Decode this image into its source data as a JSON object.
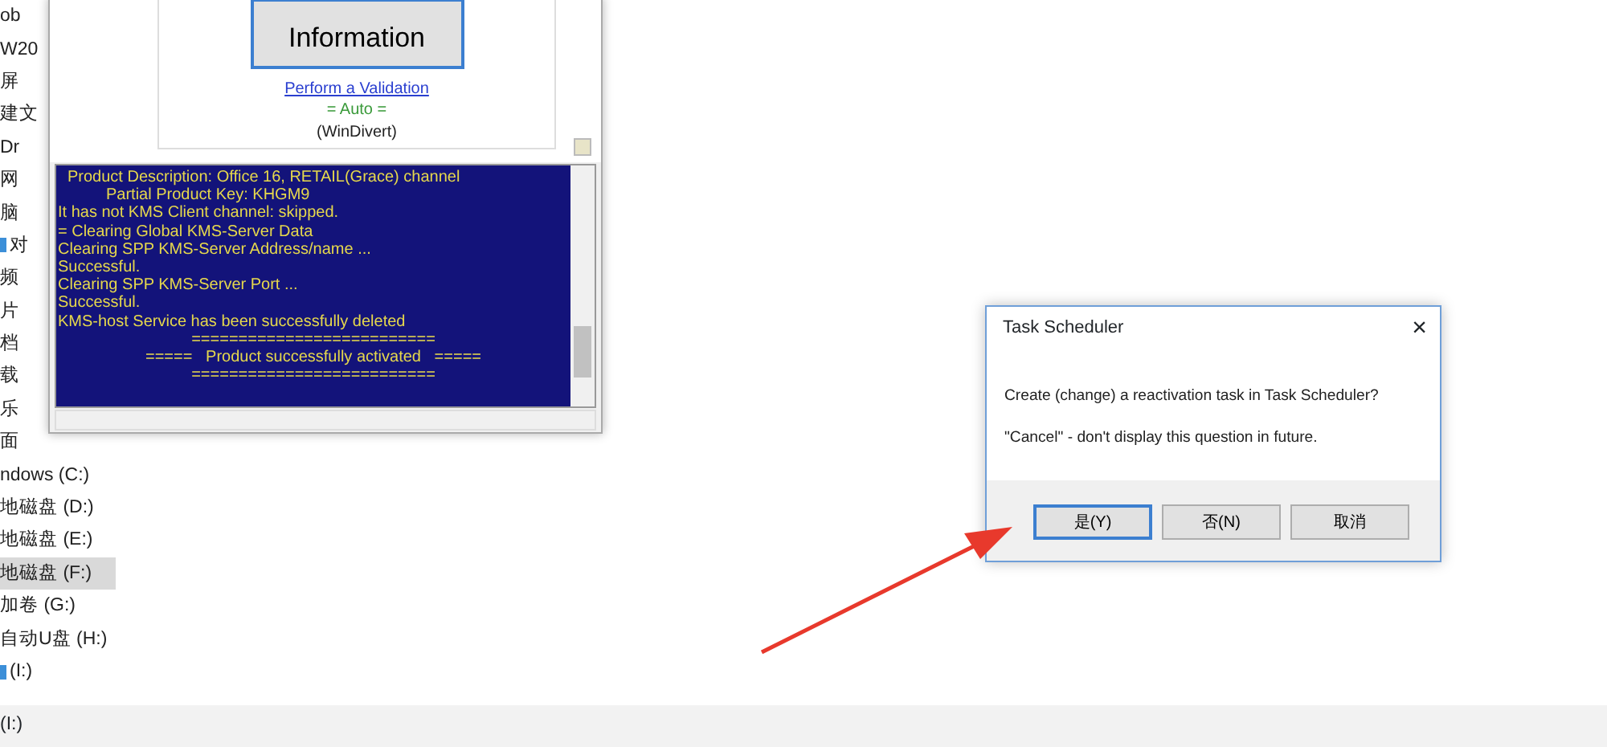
{
  "sidebar": {
    "items": [
      {
        "label": "ob",
        "selected": false,
        "icon": false
      },
      {
        "label": "W20",
        "selected": false,
        "icon": false
      },
      {
        "label": "屏",
        "selected": false,
        "icon": false
      },
      {
        "label": "建文",
        "selected": false,
        "icon": false
      },
      {
        "label": "Dr",
        "selected": false,
        "icon": false
      },
      {
        "label": "网",
        "selected": false,
        "icon": false
      },
      {
        "label": "脑",
        "selected": false,
        "icon": false
      },
      {
        "label": "对",
        "selected": false,
        "icon": true
      },
      {
        "label": "频",
        "selected": false,
        "icon": false
      },
      {
        "label": "片",
        "selected": false,
        "icon": false
      },
      {
        "label": "档",
        "selected": false,
        "icon": false
      },
      {
        "label": "载",
        "selected": false,
        "icon": false
      },
      {
        "label": "乐",
        "selected": false,
        "icon": false
      },
      {
        "label": "面",
        "selected": false,
        "icon": false
      },
      {
        "label": "ndows (C:)",
        "selected": false,
        "icon": false
      },
      {
        "label": "地磁盘 (D:)",
        "selected": false,
        "icon": false
      },
      {
        "label": "地磁盘 (E:)",
        "selected": false,
        "icon": false
      },
      {
        "label": "地磁盘 (F:)",
        "selected": true,
        "icon": false
      },
      {
        "label": "加卷 (G:)",
        "selected": false,
        "icon": false
      },
      {
        "label": "自动U盘 (H:)",
        "selected": false,
        "icon": false
      },
      {
        "label": "(I:)",
        "selected": false,
        "icon": true
      }
    ]
  },
  "status_bar": {
    "text": "(I:)"
  },
  "app_window": {
    "info_button": "Information",
    "validation_link": "Perform a Validation",
    "mode": "= Auto =",
    "method": "(WinDivert)",
    "console": [
      {
        "kind": "heading",
        "text": "Product Description: Office 16, RETAIL(Grace) channel"
      },
      {
        "kind": "subheading",
        "text": "Partial Product Key: KHGM9"
      },
      {
        "kind": "plain",
        "text": "It has not KMS Client channel: skipped."
      },
      {
        "kind": "plain",
        "text": "= Clearing Global KMS-Server Data"
      },
      {
        "kind": "plain",
        "text": "Clearing SPP KMS-Server Address/name ..."
      },
      {
        "kind": "plain",
        "text": "Successful."
      },
      {
        "kind": "plain",
        "text": "Clearing SPP KMS-Server Port ..."
      },
      {
        "kind": "plain",
        "text": "Successful."
      },
      {
        "kind": "plain",
        "text": "KMS-host Service has been successfully deleted"
      },
      {
        "kind": "center",
        "text": "=========================="
      },
      {
        "kind": "center",
        "text": "=====   Product successfully activated   ====="
      },
      {
        "kind": "center",
        "text": "=========================="
      }
    ]
  },
  "dialog": {
    "title": "Task Scheduler",
    "close": "×",
    "messages": [
      "Create (change) a reactivation task in Task Scheduler?",
      "\"Cancel\" - don't display this question in future."
    ],
    "buttons": [
      {
        "label": "是(Y)",
        "default": true
      },
      {
        "label": "否(N)",
        "default": false
      },
      {
        "label": "取消",
        "default": false
      }
    ]
  }
}
